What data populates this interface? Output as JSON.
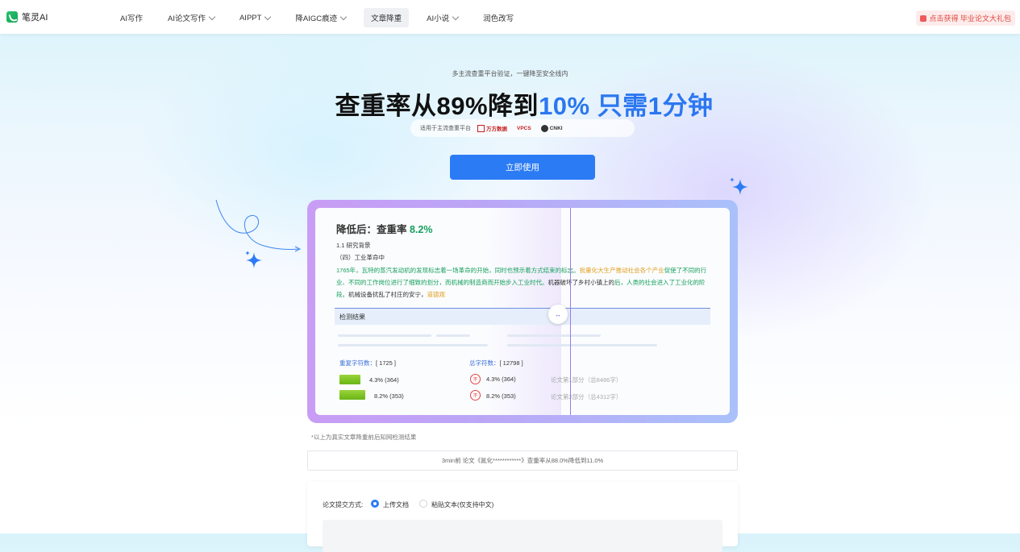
{
  "nav": {
    "logo_text": "笔灵AI",
    "items": [
      {
        "label": "AI写作",
        "dropdown": false,
        "active": false
      },
      {
        "label": "AI论文写作",
        "dropdown": true,
        "active": false
      },
      {
        "label": "AIPPT",
        "dropdown": true,
        "active": false
      },
      {
        "label": "降AIGC痕迹",
        "dropdown": true,
        "active": false
      },
      {
        "label": "文章降重",
        "dropdown": false,
        "active": true
      },
      {
        "label": "AI小说",
        "dropdown": true,
        "active": false
      },
      {
        "label": "润色改写",
        "dropdown": false,
        "active": false
      }
    ],
    "promo": "点击获得 毕业论文大礼包"
  },
  "hero": {
    "subtitle": "多主流查重平台验证，一键降至安全线内",
    "headline_part1": "查重率从89%降到",
    "headline_part2": "10% 只需1分钟",
    "platforms_label": "适用于主流查重平台",
    "platforms": [
      "万方数据",
      "VPCS",
      "CNKI"
    ],
    "cta_label": "立即使用"
  },
  "card": {
    "title_prefix": "降低后：查重率 ",
    "rate": "8.2%",
    "section_1": "1.1 研究背景",
    "section_2": "（四）工业革命中",
    "para_green_1": "1765年，瓦特的蒸汽发动机的发现标志着一场革命的开始，同时也预示着方式结束的标志。",
    "para_orange_1": "批量化大生产推动社会各个产业",
    "para_green_2": "促使了不同的行业、不同的工作岗位进行了细致的划分，而机械的制造商而开始步入工业时代。",
    "para_plain_1": "机器破坏了乡村小镇上的",
    "para_green_3": "后，人类的社会进入了工业化的阶段。",
    "para_plain_2": "机械设备扰乱了村庄的安宁，",
    "para_orange_2": "道德观",
    "results_label": "检测结果",
    "repeat_chars_label": "重复字符数：",
    "repeat_chars_value": "[ 1725 ]",
    "total_chars_label": "总字符数：",
    "total_chars_value": "[ 12798 ]",
    "rows": [
      {
        "pct_left": "4.3% (364)",
        "pct_right": "4.3% (364)",
        "part": "论文第1部分（总8486字）"
      },
      {
        "pct_left": "8.2% (353)",
        "pct_right": "8.2% (353)",
        "part": "论文第2部分（总4312字）"
      }
    ],
    "ban_glyph": "不"
  },
  "note": "*以上为真实文章降重前后知网检测结果",
  "ticker": "3min前 论文《氮化************》查重率从88.0%降低到11.0%",
  "form": {
    "label": "论文提交方式:",
    "option_upload": "上传文档",
    "option_paste": "粘贴文本(仅支持中文)"
  },
  "handle_glyph": "↔"
}
